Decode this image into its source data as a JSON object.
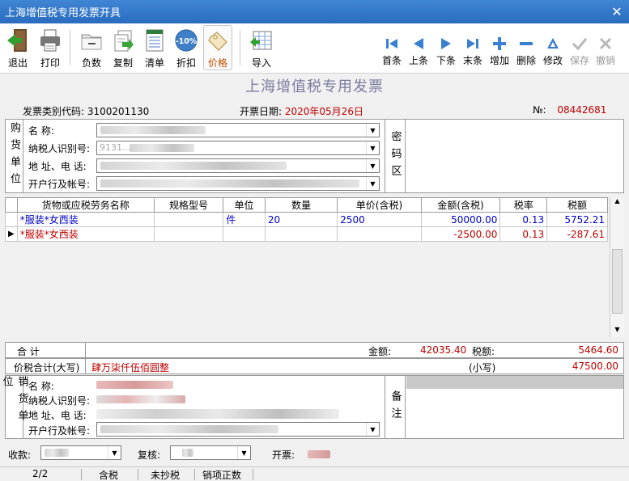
{
  "window": {
    "title": "上海增值税专用发票开具",
    "close_label": "✕"
  },
  "toolbar": {
    "left": [
      {
        "label": "退出",
        "icon": "exit-icon"
      },
      {
        "label": "打印",
        "icon": "printer-icon"
      },
      {
        "label": "负数",
        "icon": "folder-minus-icon"
      },
      {
        "label": "复制",
        "icon": "copy-icon"
      },
      {
        "label": "清单",
        "icon": "list-icon"
      },
      {
        "label": "折扣",
        "icon": "discount-icon",
        "badge": "-10%"
      },
      {
        "label": "价格",
        "icon": "price-tag-icon"
      },
      {
        "label": "导入",
        "icon": "import-icon"
      }
    ],
    "right": [
      {
        "label": "首条",
        "icon": "first-record-icon"
      },
      {
        "label": "上条",
        "icon": "prev-record-icon"
      },
      {
        "label": "下条",
        "icon": "next-record-icon"
      },
      {
        "label": "末条",
        "icon": "last-record-icon"
      },
      {
        "label": "增加",
        "icon": "add-icon"
      },
      {
        "label": "删除",
        "icon": "delete-icon"
      },
      {
        "label": "修改",
        "icon": "edit-icon"
      },
      {
        "label": "保存",
        "icon": "save-check-icon",
        "disabled": true
      },
      {
        "label": "撤销",
        "icon": "undo-x-icon",
        "disabled": true
      }
    ]
  },
  "invoice": {
    "title": "上海增值税专用发票",
    "type_code_label": "发票类别代码:",
    "type_code": "3100201130",
    "date_label": "开票日期:",
    "date": "2020年05月26日",
    "no_label": "№:",
    "no": "08442681"
  },
  "buyer": {
    "section_label": "购货单位",
    "name_label": "名        称:",
    "taxid_label": "纳税人识别号:",
    "address_label": "地 址、电 话:",
    "bank_label": "开户行及帐号:",
    "taxid_value": "9131...",
    "cipher_label": "密码区"
  },
  "items": {
    "headers": [
      "货物或应税劳务名称",
      "规格型号",
      "单位",
      "数量",
      "单价(含税)",
      "金额(含税)",
      "税率",
      "税额"
    ],
    "rows": [
      {
        "name": "*服装*女西装",
        "spec": "",
        "unit": "件",
        "qty": "20",
        "price": "2500",
        "amount": "50000.00",
        "rate": "0.13",
        "tax": "5752.21",
        "color": "blue",
        "marker": ""
      },
      {
        "name": "*服装*女西装",
        "spec": "",
        "unit": "",
        "qty": "",
        "price": "",
        "amount": "-2500.00",
        "rate": "0.13",
        "tax": "-287.61",
        "color": "red",
        "marker": "▶"
      }
    ]
  },
  "totals": {
    "sum_label": "合        计",
    "amount_label": "金额:",
    "amount": "42035.40",
    "tax_label": "税额:",
    "tax": "5464.60",
    "caps_label": "价税合计(大写)",
    "caps_value": "肆万柒仟伍佰圆整",
    "small_label": "(小写)",
    "small_value": "47500.00"
  },
  "seller": {
    "section_label": "销货单位",
    "name_label": "名        称:",
    "taxid_label": "纳税人识别号:",
    "address_label": "地 址、电 话:",
    "bank_label": "开户行及帐号:",
    "remark_label": "备注"
  },
  "signers": {
    "payee_label": "收款:",
    "reviewer_label": "复核:",
    "drawer_label": "开票:"
  },
  "status": {
    "page": "2/2",
    "tax_mode": "含税",
    "copy_state": "未抄税",
    "sale_type": "销项正数"
  }
}
